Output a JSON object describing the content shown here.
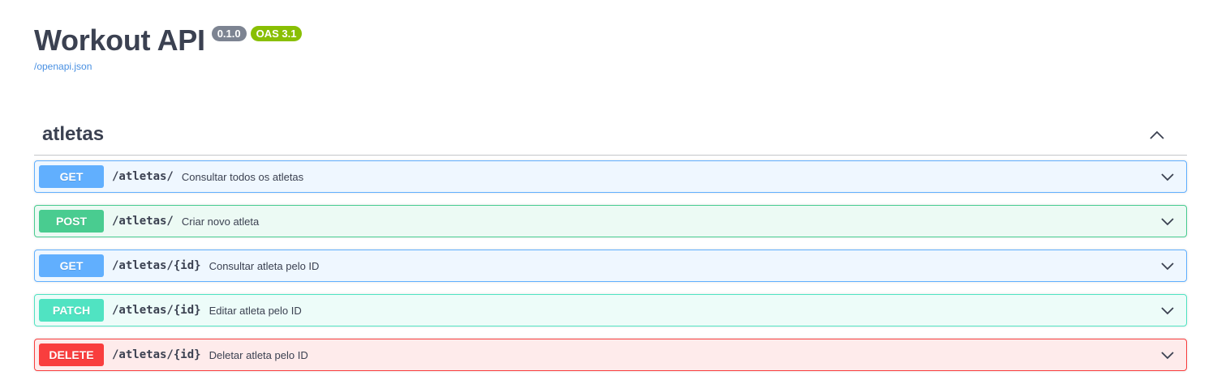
{
  "info": {
    "title": "Workout API",
    "version": "0.1.0",
    "oas": "OAS 3.1",
    "spec_link": "/openapi.json"
  },
  "tag": {
    "name": "atletas",
    "collapse_icon": "chevron-up-icon"
  },
  "operations": [
    {
      "method": "GET",
      "path": "/atletas/",
      "summary": "Consultar todos os atletas",
      "color": "#61affe"
    },
    {
      "method": "POST",
      "path": "/atletas/",
      "summary": "Criar novo atleta",
      "color": "#49cc90"
    },
    {
      "method": "GET",
      "path": "/atletas/{id}",
      "summary": "Consultar atleta pelo ID",
      "color": "#61affe"
    },
    {
      "method": "PATCH",
      "path": "/atletas/{id}",
      "summary": "Editar atleta pelo ID",
      "color": "#50e3c2"
    },
    {
      "method": "DELETE",
      "path": "/atletas/{id}",
      "summary": "Deletar atleta pelo ID",
      "color": "#f93e3e"
    }
  ],
  "colors": {
    "text": "#3b4151",
    "link": "#4990e2",
    "version_badge": "#7d8492",
    "oas_badge": "#89bf04"
  }
}
